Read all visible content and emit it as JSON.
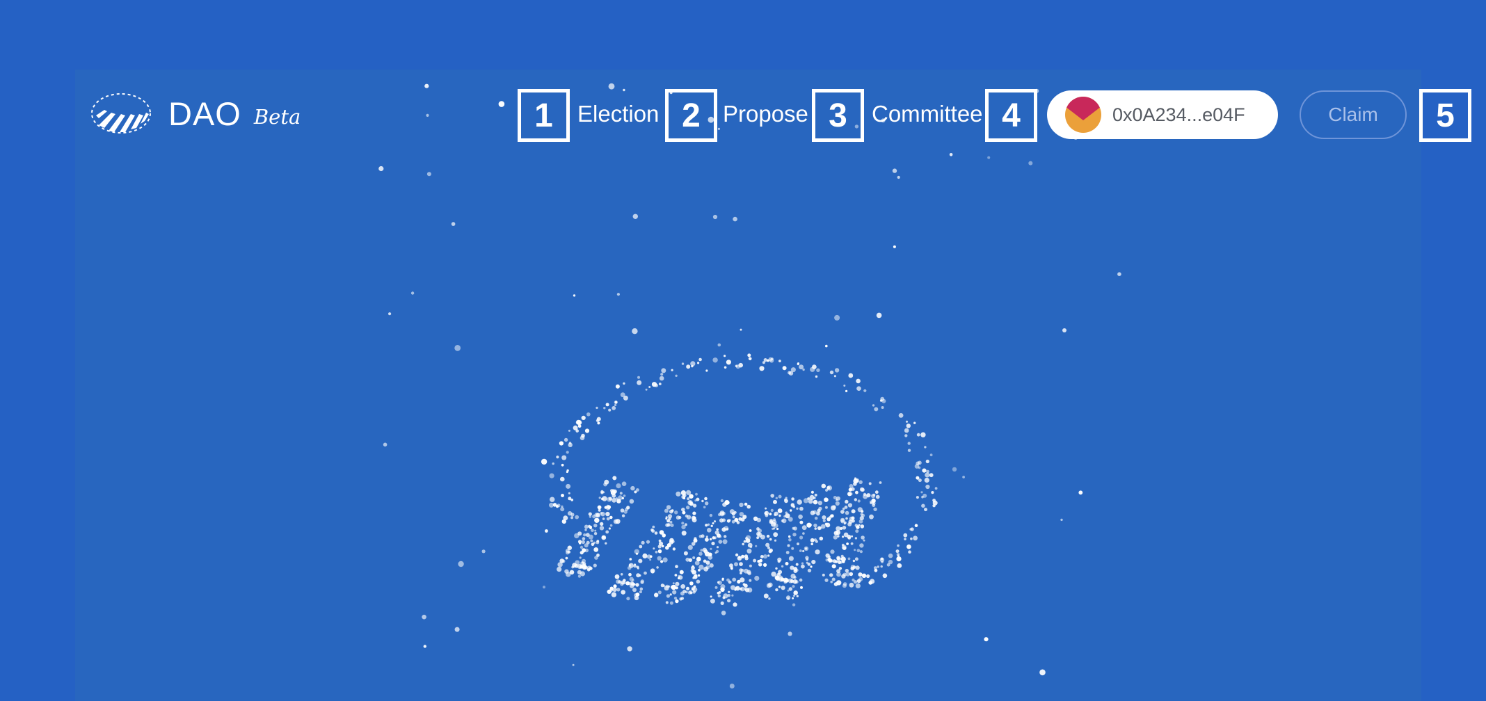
{
  "brand": {
    "name": "DAO",
    "badge": "Beta",
    "logo_icon": "dao-ring-logo-icon"
  },
  "nav": {
    "items": [
      {
        "label": "Election"
      },
      {
        "label": "Propose"
      },
      {
        "label": "Committee"
      }
    ]
  },
  "markers": [
    "1",
    "2",
    "3",
    "4",
    "5"
  ],
  "wallet": {
    "address": "0x0A234...e04F",
    "avatar_icon": "wallet-avatar-icon"
  },
  "claim": {
    "label": "Claim"
  },
  "hero": {
    "icon": "particle-dao-logo-illustration"
  },
  "colors": {
    "background": "#2561c4",
    "panel": "#2866bf",
    "text": "#ffffff",
    "wallet_bg": "#ffffff",
    "wallet_text": "#555a62",
    "claim_border": "#6f95d9",
    "claim_text": "#a9c0ea",
    "avatar_top": "#c8285a",
    "avatar_bottom": "#eba03a"
  }
}
